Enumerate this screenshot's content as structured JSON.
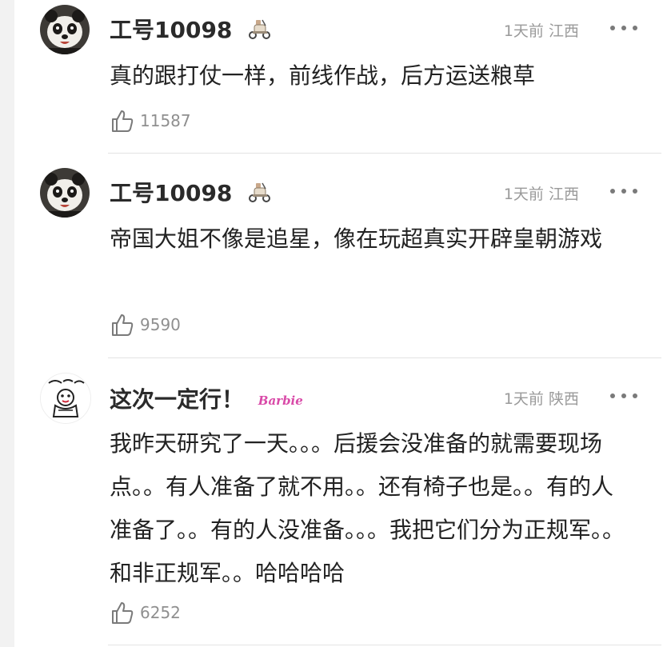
{
  "comments": [
    {
      "username": "工号10098",
      "time": "1天前",
      "location": "江西",
      "text": "真的跟打仗一样，前线作战，后方运送粮草",
      "likes": "11587",
      "avatar": "panda-avatar",
      "badge": "scooter-badge"
    },
    {
      "username": "工号10098",
      "time": "1天前",
      "location": "江西",
      "text": "帝国大姐不像是追星，像在玩超真实开辟皇朝游戏",
      "likes": "9590",
      "avatar": "panda-avatar",
      "badge": "scooter-badge"
    },
    {
      "username": "这次一定行！",
      "time": "1天前",
      "location": "陕西",
      "text": "我昨天研究了一天。。。后援会没准备的就需要现场点。。有人准备了就不用。。还有椅子也是。。有的人准备了。。有的人没准备。。。我把它们分为正规军。。和非正规军。。哈哈哈哈",
      "likes": "6252",
      "avatar": "cartoon-sketch-avatar",
      "badge": "barbie-badge",
      "badge_text": "Barbie"
    }
  ],
  "colors": {
    "username": "#2a2a2a",
    "meta": "#9a9a9a",
    "text": "#222222",
    "divider": "#e3e3e3",
    "badge_pink": "#d94aa8"
  }
}
